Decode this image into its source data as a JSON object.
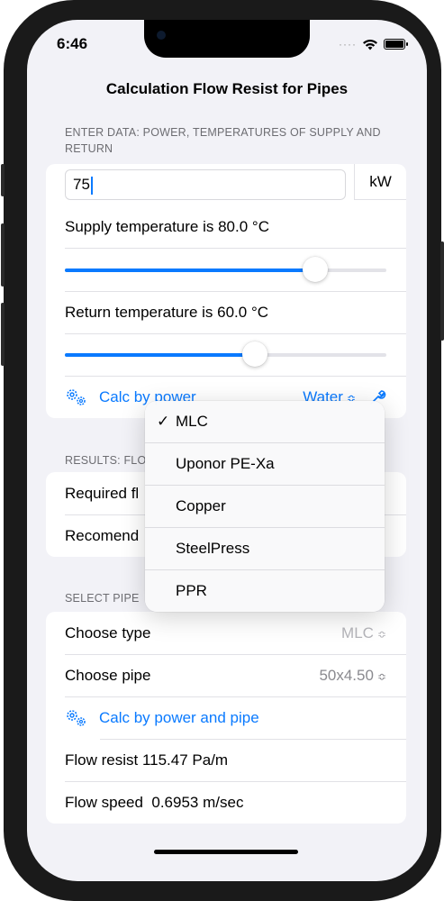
{
  "status": {
    "time": "6:46"
  },
  "nav": {
    "title": "Calculation Flow Resist for Pipes"
  },
  "input_section": {
    "header": "ENTER DATA: POWER, TEMPERATURES OF SUPPLY AND RETURN",
    "power_value": "75",
    "power_unit": "kW",
    "supply_label": "Supply temperature is 80.0 °C",
    "supply_slider_fraction": 0.78,
    "return_label": "Return temperature is 60.0 °C",
    "return_slider_fraction": 0.59,
    "calc_button": "Calc by power",
    "medium_value": "Water",
    "icons": {
      "calc": "gears-icon",
      "settings": "wrench-icon"
    }
  },
  "results_section": {
    "header": "RESULTS: FLO",
    "rows": [
      "Required fl",
      "Recomend"
    ]
  },
  "pipe_section": {
    "header": "SELECT PIPE",
    "type_label": "Choose type",
    "type_value": "MLC",
    "pipe_label": "Choose pipe",
    "pipe_value": "50x4.50",
    "calc_button": "Calc by power and pipe",
    "flow_resist": "Flow resist 115.47 Pa/m",
    "flow_speed": "Flow speed  0.6953 m/sec"
  },
  "dropdown_menu": {
    "selected": "MLC",
    "items": [
      "MLC",
      "Uponor PE-Xa",
      "Copper",
      "SteelPress",
      "PPR"
    ]
  },
  "colors": {
    "accent": "#0a7aff",
    "background": "#f2f2f7"
  }
}
